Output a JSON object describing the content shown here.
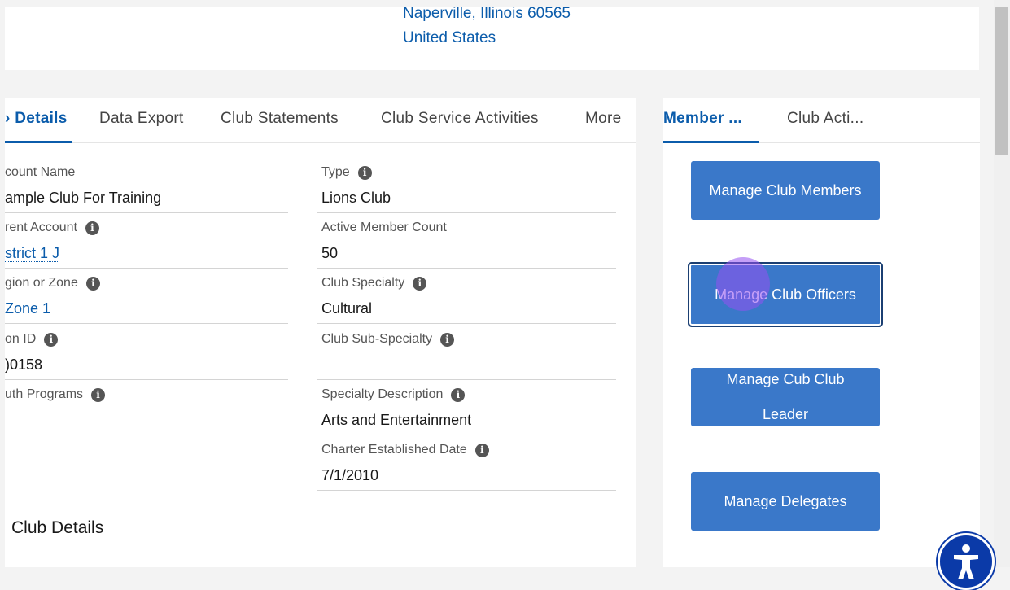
{
  "address": {
    "line1": "Naperville, Illinois 60565",
    "line2": "United States"
  },
  "tabs": [
    {
      "label": "› Details",
      "active": true
    },
    {
      "label": "Data Export",
      "active": false
    },
    {
      "label": "Club Statements",
      "active": false
    },
    {
      "label": "Club Service Activities",
      "active": false
    },
    {
      "label": "More",
      "active": false
    }
  ],
  "side_tabs": [
    {
      "label": "Member ...",
      "active": true
    },
    {
      "label": "Club Acti...",
      "active": false
    }
  ],
  "fields_left": [
    {
      "label": "count Name",
      "value": "ample Club For Training"
    },
    {
      "label": "rent Account",
      "value": "strict 1 J"
    },
    {
      "label": "gion or Zone",
      "value": "Zone 1"
    },
    {
      "label": "on ID",
      "value": ")0158"
    },
    {
      "label": "uth Programs",
      "value": ""
    }
  ],
  "fields_right": [
    {
      "label": "Type",
      "value": "Lions Club"
    },
    {
      "label": "Active Member Count",
      "value": "50"
    },
    {
      "label": "Club Specialty",
      "value": "Cultural"
    },
    {
      "label": "Club Sub-Specialty",
      "value": ""
    },
    {
      "label": "Specialty Description",
      "value": "Arts and Entertainment"
    },
    {
      "label": "Charter Established Date",
      "value": "7/1/2010"
    }
  ],
  "section_title": "Club Details",
  "buttons": {
    "manage_members": "Manage Club Members",
    "manage_officers": "Manage Club Officers",
    "manage_cub_line1": "Manage Cub Club",
    "manage_cub_line2": "Leader",
    "manage_delegates": "Manage Delegates"
  },
  "icons": {
    "info": "info-icon",
    "accessibility": "accessibility-icon"
  },
  "colors": {
    "link": "#0b5cab",
    "button": "#3a78c9",
    "a11y": "#0b3aa8"
  }
}
